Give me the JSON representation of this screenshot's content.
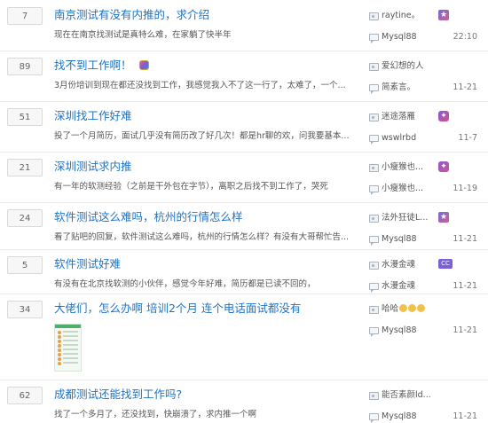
{
  "threads": [
    {
      "count": "7",
      "title": "南京测试有没有内推的，求介绍",
      "summary": "现在在南京找测试是真特么难，在家躺了快半年",
      "author": "raytine。",
      "author_medal": "★",
      "replier": "Mysql88",
      "time": "22:10"
    },
    {
      "count": "89",
      "title": "找不到工作啊！",
      "has_badge": true,
      "summary": "3月份培训到现在都还没找到工作，我感觉我入不了这一行了，太难了，一个...",
      "author": "爱幻想的人",
      "replier": "简素言。",
      "time": "11-21"
    },
    {
      "count": "51",
      "title": "深圳找工作好难",
      "summary": "投了一个月简历，面试几乎没有简历改了好几次！都是hr聊的欢，问我要基本...",
      "author": "迷途落雁",
      "author_medal": "✦",
      "replier": "wswlrbd",
      "time": "11-7"
    },
    {
      "count": "21",
      "title": "深圳测试求内推",
      "summary": "有一年的软测经验（之前是干外包在字节），离职之后找不到工作了，哭死",
      "author": "小瘦猴也...",
      "author_medal": "✦",
      "replier": "小瘦猴也...",
      "time": "11-19"
    },
    {
      "count": "24",
      "title": "软件测试这么难吗，杭州的行情怎么样",
      "summary": "看了贴吧的回复，软件测试这么难吗，杭州的行情怎么样？有没有大哥帮忙告...",
      "author": "法外狂徒L...",
      "author_medal": "★",
      "replier": "Mysql88",
      "time": "11-21"
    },
    {
      "count": "5",
      "title": "软件测试好难",
      "summary": "有没有在北京找软测的小伙伴，感觉今年好难，简历都是已读不回的，",
      "author": "水漫金魂",
      "author_medal": "CC",
      "replier": "水漫金魂",
      "time": "11-21"
    },
    {
      "count": "34",
      "title": "大佬们，怎么办啊 培训2个月 连个电话面试都没有",
      "has_thumb": true,
      "author": "哈哈",
      "author_emoji_count": 3,
      "replier": "Mysql88",
      "time": "11-21"
    },
    {
      "count": "62",
      "title": "成都测试还能找到工作吗?",
      "summary": "找了一个多月了，还没找到，快崩溃了，求内推一个啊",
      "author": "能否素颜ld...",
      "replier": "Mysql88",
      "time": "11-21"
    }
  ]
}
